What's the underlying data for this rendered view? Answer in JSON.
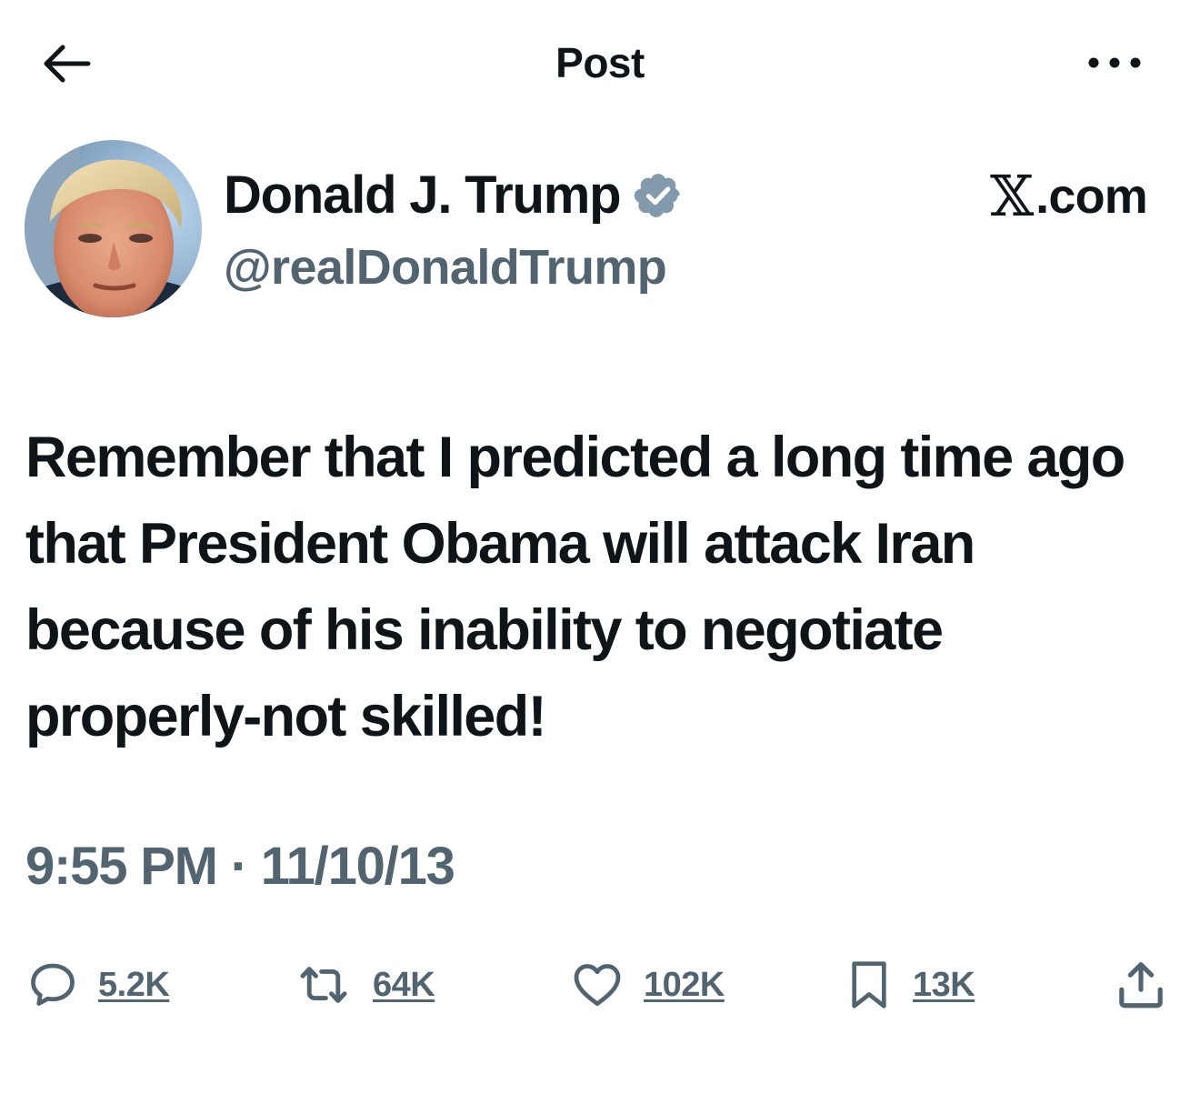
{
  "header": {
    "title": "Post",
    "back_icon": "arrow-left-icon",
    "more_icon": "ellipsis-icon"
  },
  "author": {
    "display_name": "Donald J. Trump",
    "handle": "@realDonaldTrump",
    "verified": true,
    "verified_color": "#829aab"
  },
  "source": {
    "logo_glyph": "𝕏",
    "label": ".com"
  },
  "post": {
    "text": "Remember that I predicted a long time ago that President Obama will attack Iran because of his inability to negotiate properly-not skilled!",
    "timestamp": "9:55 PM · 11/10/13"
  },
  "actions": {
    "replies": "5.2K",
    "reposts": "64K",
    "likes": "102K",
    "bookmarks": "13K"
  },
  "colors": {
    "text_primary": "#0f1419",
    "text_secondary": "#536471",
    "background": "#ffffff"
  }
}
